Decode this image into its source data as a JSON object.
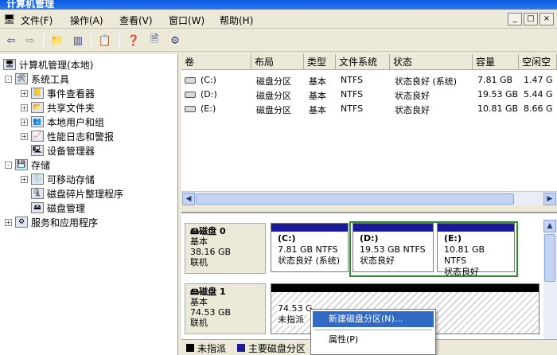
{
  "window": {
    "title": "计算机管理"
  },
  "menu": {
    "items": [
      "文件(F)",
      "操作(A)",
      "查看(V)",
      "窗口(W)",
      "帮助(H)"
    ],
    "window_controls": [
      "_",
      "□",
      "×"
    ]
  },
  "toolbar": {
    "icons": [
      "back-arrow-icon",
      "forward-arrow-icon",
      "up-folder-icon",
      "show-hide-tree-icon",
      "properties-icon",
      "help-icon",
      "export-icon",
      "settings-icon"
    ]
  },
  "tree": {
    "root": "计算机管理(本地)",
    "items": [
      {
        "label": "系统工具",
        "level": 1,
        "expander": "-"
      },
      {
        "label": "事件查看器",
        "level": 2,
        "expander": "+"
      },
      {
        "label": "共享文件夹",
        "level": 2,
        "expander": "+"
      },
      {
        "label": "本地用户和组",
        "level": 2,
        "expander": "+"
      },
      {
        "label": "性能日志和警报",
        "level": 2,
        "expander": "+"
      },
      {
        "label": "设备管理器",
        "level": 2,
        "expander": ""
      },
      {
        "label": "存储",
        "level": 1,
        "expander": "-"
      },
      {
        "label": "可移动存储",
        "level": 2,
        "expander": "+"
      },
      {
        "label": "磁盘碎片整理程序",
        "level": 2,
        "expander": ""
      },
      {
        "label": "磁盘管理",
        "level": 2,
        "expander": ""
      },
      {
        "label": "服务和应用程序",
        "level": 1,
        "expander": "+"
      }
    ]
  },
  "volumes": {
    "headers": [
      "卷",
      "布局",
      "类型",
      "文件系统",
      "状态",
      "容量",
      "空闲空"
    ],
    "rows": [
      [
        "(C:)",
        "磁盘分区",
        "基本",
        "NTFS",
        "状态良好 (系统)",
        "7.81 GB",
        "1.47 G"
      ],
      [
        "(D:)",
        "磁盘分区",
        "基本",
        "NTFS",
        "状态良好",
        "19.53 GB",
        "5.44 G"
      ],
      [
        "(E:)",
        "磁盘分区",
        "基本",
        "NTFS",
        "状态良好",
        "10.81 GB",
        "8.66 G"
      ]
    ]
  },
  "disks": [
    {
      "name": "磁盘 0",
      "type": "基本",
      "size": "38.16 GB",
      "status": "联机",
      "partitions": [
        {
          "name": "(C:)",
          "info": "7.81 GB NTFS",
          "status": "状态良好 (系统)",
          "selected": false
        },
        {
          "name": "(D:)",
          "info": "19.53 GB NTFS",
          "status": "状态良好",
          "selected": true
        },
        {
          "name": "(E:)",
          "info": "10.81 GB NTFS",
          "status": "状态良好",
          "selected": true
        }
      ]
    },
    {
      "name": "磁盘 1",
      "type": "基本",
      "size": "74.53 GB",
      "status": "联机",
      "partitions": [
        {
          "name": "",
          "info": "74.53 G",
          "status": "未指派",
          "selected": false
        }
      ]
    }
  ],
  "legend": {
    "items": [
      {
        "label": "未指派",
        "color": "#000000"
      },
      {
        "label": "主要磁盘分区",
        "color": "#1a1a9b"
      }
    ]
  },
  "context_menu": {
    "items": [
      "新建磁盘分区(N)...",
      "属性(P)"
    ]
  },
  "colors": {
    "title_bar": "#0a5ae0",
    "selected_partition_border": "#2e8b2e",
    "primary_partition": "#1a1a9b",
    "unallocated": "#000000",
    "menu_highlight": "#316ac5"
  }
}
